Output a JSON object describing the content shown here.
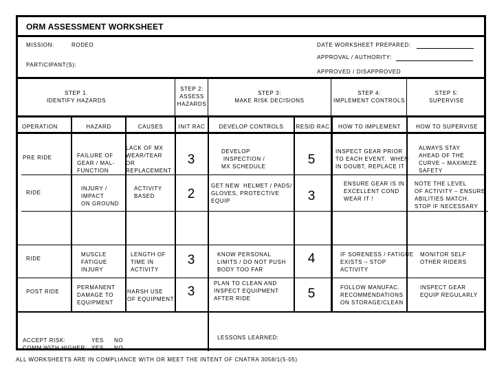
{
  "title": "ORM ASSESSMENT WORKSHEET",
  "header": {
    "mission_label": "MISSION:",
    "mission_value": "RODEO",
    "participants_label": "PARTICIPANT(S):",
    "date_label": "DATE WORKSHEET PREPARED:",
    "approval_label": "APPROVAL / AUTHORITY:",
    "approved_label": "APPROVED / DISAPPROVED"
  },
  "steps": {
    "step1": "STEP 1.\nIDENTIFY HAZARDS",
    "step2": "STEP 2:\nASSESS\nHAZARDS",
    "step3": "STEP 3:\nMAKE RISK DECISIONS",
    "step4": "STEP 4:\nIMPLEMENT CONTROLS",
    "step5": "STEP 5:\nSUPERVISE"
  },
  "columns": [
    "OPERATION",
    "HAZARD",
    "CAUSES",
    "INIT RAC",
    "DEVELOP CONTROLS",
    "RESID RAC",
    "HOW TO IMPLEMENT",
    "HOW TO SUPERVISE"
  ],
  "rows": [
    {
      "operation": "PRE RIDE",
      "hazard": "FAILURE OF\nGEAR / MAL-\nFUNCTION",
      "causes": "LACK OF MX\nWEAR/TEAR\nOR\nREPLACEMENT",
      "init_rac": "3",
      "controls": "DEVELOP\n INSPECTION /\nMX SCHEDULE",
      "resid_rac": "5",
      "implement": "INSPECT GEAR PRIOR\nTO EACH EVENT.  WHEN\nIN DOUBT, REPLACE IT",
      "supervise": "ALWAYS STAY\nAHEAD OF THE\nCURVE – MAXIMIZE\nSAFETY"
    },
    {
      "operation": "RIDE",
      "hazard": "INJURY /\nIMPACT\nON GROUND",
      "causes": "ACTIVITY\nBASED",
      "init_rac": "2",
      "controls": "GET NEW  HELMET / PADS/\nGLOVES, PROTECTIVE\nEQUIP",
      "resid_rac": "3",
      "implement": "ENSURE GEAR IS IN\nEXCELLENT COND\nWEAR IT !",
      "supervise": "NOTE THE LEVEL\nOF ACTIVITY – ENSURE\nABILITIES MATCH.\nSTOP IF NECESSARY"
    },
    {
      "operation": "",
      "hazard": "",
      "causes": "",
      "init_rac": "",
      "controls": "",
      "resid_rac": "",
      "implement": "",
      "supervise": ""
    },
    {
      "operation": "RIDE",
      "hazard": "MUSCLE\nFATIGUE\nINJURY",
      "causes": "LENGTH OF\nTIME IN\nACTIVITY",
      "init_rac": "3",
      "controls": "KNOW PERSONAL\nLIMITS / DO NOT PUSH\nBODY TOO FAR",
      "resid_rac": "4",
      "implement": "IF SORENESS / FATIGUE\nEXISTS – STOP\nACTIVITY",
      "supervise": "MONITOR SELF\nOTHER RIDERS"
    },
    {
      "operation": "POST RIDE",
      "hazard": "PERMANENT\nDAMAGE TO\nEQUIPMENT",
      "causes": "HARSH USE\nOF EQUIPMENT",
      "init_rac": "3",
      "controls": "PLAN TO CLEAN AND\nINSPECT EQUIPMENT\nAFTER RIDE",
      "resid_rac": "5",
      "implement": "FOLLOW MANUFAC.\nRECOMMENDATIONS\nON STORAGE/CLEAN",
      "supervise": "INSPECT GEAR\nEQUIP REGULARLY"
    }
  ],
  "bottom": {
    "accept_risk_label": "ACCEPT RISK:",
    "comm_label": "COMM WITH HIGHER:",
    "yes": "YES",
    "no": "NO",
    "lessons_label": "LESSONS LEARNED:"
  },
  "footer": "ALL WORKSHEETS ARE IN COMPLIANCE WITH OR MEET THE INTENT OF CNATRA 3058/1(5-05)"
}
